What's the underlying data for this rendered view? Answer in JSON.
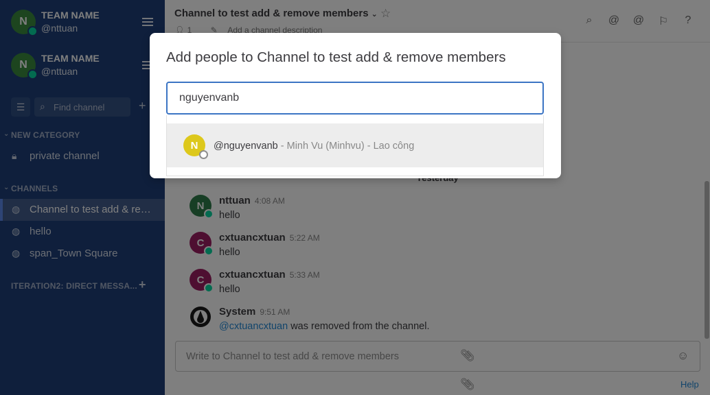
{
  "sidebar": {
    "teams": [
      {
        "initial": "N",
        "name": "TEAM NAME",
        "user": "@nttuan"
      },
      {
        "initial": "N",
        "name": "TEAM NAME",
        "user": "@nttuan"
      }
    ],
    "find_placeholder": "Find channel",
    "categories": [
      {
        "label": "NEW CATEGORY",
        "items": [
          {
            "label": "private channel",
            "icon": "lock-icon"
          }
        ]
      },
      {
        "label": "CHANNELS",
        "items": [
          {
            "label": "Channel to test add & remove members",
            "icon": "globe-icon",
            "active": true
          },
          {
            "label": "hello",
            "icon": "globe-icon"
          },
          {
            "label": "span_Town Square",
            "icon": "globe-icon"
          }
        ]
      },
      {
        "label": "ITERATION2: DIRECT MESSA...",
        "items": []
      }
    ]
  },
  "header": {
    "title": "Channel to test add & remove members",
    "member_count": "1",
    "description_placeholder": "Add a channel description"
  },
  "messages": {
    "date_separator": "Yesterday",
    "posts": [
      {
        "initial": "N",
        "avatar_color": "#2e7d4a",
        "author": "nttuan",
        "time": "4:08 AM",
        "text": "hello"
      },
      {
        "initial": "C",
        "avatar_color": "#9c1e63",
        "author": "cxtuancxtuan",
        "time": "5:22 AM",
        "text": "hello"
      },
      {
        "initial": "C",
        "avatar_color": "#9c1e63",
        "author": "cxtuancxtuan",
        "time": "5:33 AM",
        "text": "hello"
      },
      {
        "initial": "",
        "avatar_color": "#1a1a1a",
        "author": "System",
        "time": "9:51 AM",
        "mention": "@cxtuancxtuan",
        "text": " was removed from the channel."
      }
    ]
  },
  "composer": {
    "placeholder": "Write to Channel to test add & remove members",
    "help_label": "Help"
  },
  "modal": {
    "title": "Add people to Channel to test add & remove members",
    "input_value": "nguyenvanb",
    "suggestions": [
      {
        "initial": "N",
        "username": "@nguyenvanb",
        "details": " - Minh Vu (Minhvu) - Lao công"
      }
    ]
  },
  "colors": {
    "sidebar_bg": "#1e3f78",
    "accent": "#3b74c4",
    "link": "#2389d7",
    "online": "#06d6a0"
  }
}
